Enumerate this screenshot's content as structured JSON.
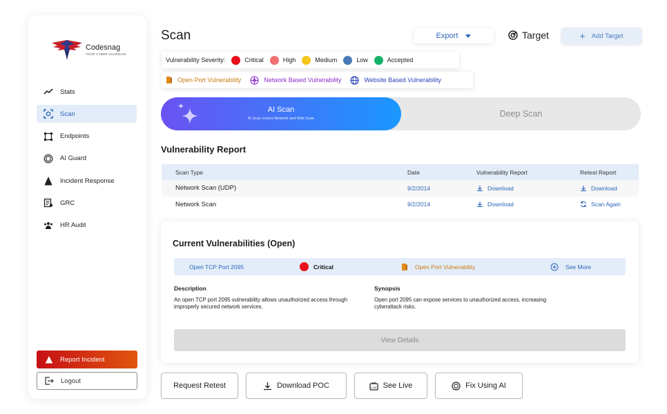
{
  "brand": {
    "name": "Codesnag",
    "tagline": "YOUR CYBER GUARDIAN"
  },
  "sidebar": {
    "items": [
      {
        "label": "Stats",
        "icon": "line-chart-icon",
        "active": false
      },
      {
        "label": "Scan",
        "icon": "scan-icon",
        "active": true
      },
      {
        "label": "Endpoints",
        "icon": "endpoints-icon",
        "active": false
      },
      {
        "label": "AI Guard",
        "icon": "ai-guard-icon",
        "active": false
      },
      {
        "label": "Incident Response",
        "icon": "incident-icon",
        "active": false
      },
      {
        "label": "GRC",
        "icon": "grc-icon",
        "active": false
      },
      {
        "label": "HR Audit",
        "icon": "hr-audit-icon",
        "active": false
      }
    ],
    "report_incident": "Report Incident",
    "logout": "Logout"
  },
  "header": {
    "title": "Scan",
    "export_label": "Export",
    "target_label": "Target",
    "add_target_label": "Add Target"
  },
  "severity_legend": {
    "label": "Vulnerability Severity:",
    "items": [
      {
        "label": "Critical",
        "color": "#e8101b"
      },
      {
        "label": "High",
        "color": "#f07070"
      },
      {
        "label": "Medium",
        "color": "#f5c518"
      },
      {
        "label": "Low",
        "color": "#4a7bb5"
      },
      {
        "label": "Accepted",
        "color": "#17b26a"
      }
    ]
  },
  "type_legend": {
    "items": [
      {
        "label": "Open Port Vulnerability",
        "color": "#c97a10",
        "icon": "open-port-icon"
      },
      {
        "label": "Network Based Vulnerability",
        "color": "#8a2bc9",
        "icon": "network-icon"
      },
      {
        "label": "Website Based Vulnerability",
        "color": "#2a3fb8",
        "icon": "globe-icon"
      }
    ]
  },
  "scan_toggle": {
    "ai_title": "AI Scan",
    "ai_subtitle": "AI Scan covers Network and Web Scan",
    "deep_title": "Deep Scan"
  },
  "report": {
    "title": "Vulnerability Report",
    "columns": [
      "Scan Type",
      "Date",
      "Vulnerability Report",
      "Retest Report"
    ],
    "rows": [
      {
        "scan_type": "Network Scan (UDP)",
        "date": "9/2/2014",
        "report": "Download",
        "retest": "Download"
      },
      {
        "scan_type": "Network Scan",
        "date": "9/2/2014",
        "report": "Download",
        "retest": "Scan Again"
      }
    ]
  },
  "current_vulns": {
    "title": "Current Vulnerabilities (Open)",
    "row": {
      "name": "Open TCP Port 2095",
      "severity": "Critical",
      "type": "Open Port Vulnerability",
      "action": "See More"
    },
    "description_heading": "Description",
    "description": "An open TCP port 2095 vulnerability allows unauthorized access through improperly secured network services.",
    "synopsis_heading": "Synopsis",
    "synopsis": "Open port 2095 can expose services to unauthorized access, increasing cyberattack risks.",
    "view_details": "View Details"
  },
  "actions": {
    "request_retest": "Request Retest",
    "download_poc": "Download POC",
    "see_live": "See Live",
    "fix_ai": "Fix Using AI"
  }
}
